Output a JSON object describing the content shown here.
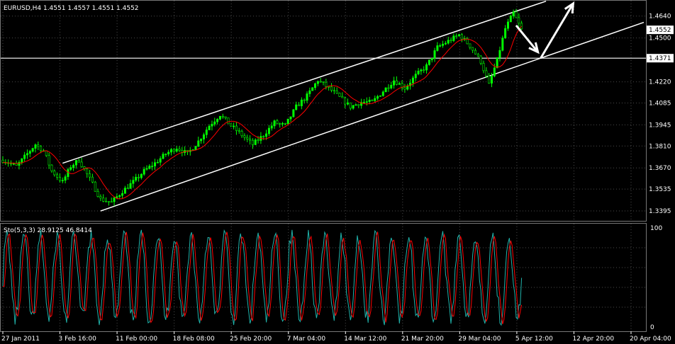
{
  "chart_data": [
    {
      "type": "candlestick",
      "title": "EURUSD,H4  1.4551 1.4557 1.4551 1.4552",
      "ylim": [
        1.335,
        1.472
      ],
      "y_ticks": [
        "1.4640",
        "1.4500",
        "1.4220",
        "1.4085",
        "1.3945",
        "1.3810",
        "1.3670",
        "1.3535",
        "1.3395"
      ],
      "y_tick_values": [
        1.464,
        1.45,
        1.422,
        1.4085,
        1.3945,
        1.381,
        1.367,
        1.3535,
        1.3395
      ],
      "x_ticks": [
        "27 Jan 2011",
        "3 Feb 16:00",
        "11 Feb 00:00",
        "18 Feb 08:00",
        "25 Feb 20:00",
        "7 Mar 04:00",
        "14 Mar 12:00",
        "21 Mar 20:00",
        "29 Mar 04:00",
        "5 Apr 12:00",
        "12 Apr 20:00",
        "20 Apr 04:00"
      ],
      "price_curve": [
        [
          0,
          1.372
        ],
        [
          5,
          1.368
        ],
        [
          9,
          1.376
        ],
        [
          12,
          1.382
        ],
        [
          15,
          1.378
        ],
        [
          18,
          1.365
        ],
        [
          22,
          1.358
        ],
        [
          25,
          1.368
        ],
        [
          28,
          1.372
        ],
        [
          32,
          1.36
        ],
        [
          36,
          1.347
        ],
        [
          40,
          1.345
        ],
        [
          44,
          1.352
        ],
        [
          48,
          1.358
        ],
        [
          52,
          1.365
        ],
        [
          56,
          1.37
        ],
        [
          60,
          1.376
        ],
        [
          64,
          1.38
        ],
        [
          68,
          1.376
        ],
        [
          72,
          1.384
        ],
        [
          76,
          1.394
        ],
        [
          80,
          1.401
        ],
        [
          84,
          1.394
        ],
        [
          88,
          1.388
        ],
        [
          92,
          1.382
        ],
        [
          96,
          1.388
        ],
        [
          100,
          1.396
        ],
        [
          104,
          1.394
        ],
        [
          108,
          1.406
        ],
        [
          112,
          1.413
        ],
        [
          116,
          1.423
        ],
        [
          120,
          1.418
        ],
        [
          124,
          1.412
        ],
        [
          128,
          1.406
        ],
        [
          132,
          1.409
        ],
        [
          136,
          1.409
        ],
        [
          140,
          1.416
        ],
        [
          144,
          1.423
        ],
        [
          148,
          1.418
        ],
        [
          152,
          1.426
        ],
        [
          156,
          1.432
        ],
        [
          160,
          1.444
        ],
        [
          164,
          1.448
        ],
        [
          168,
          1.452
        ],
        [
          172,
          1.445
        ],
        [
          176,
          1.435
        ],
        [
          179,
          1.42
        ],
        [
          182,
          1.436
        ],
        [
          185,
          1.456
        ],
        [
          188,
          1.466
        ],
        [
          191,
          1.4552
        ]
      ],
      "x_max": 236,
      "ma_lag": 3,
      "levels": [
        {
          "label": "1.4552",
          "value": 1.4552,
          "line": false
        },
        {
          "label": "1.4371",
          "value": 1.4371,
          "line": true
        }
      ],
      "trend_lines": [
        {
          "from": [
            22,
            1.37
          ],
          "to": [
            200,
            1.4735
          ]
        },
        {
          "from": [
            36,
            1.3395
          ],
          "to": [
            236,
            1.46
          ]
        }
      ],
      "arrows": [
        {
          "from": [
            189,
            1.458
          ],
          "to": [
            197,
            1.441
          ]
        },
        {
          "from": [
            198,
            1.437
          ],
          "to": [
            210,
            1.472
          ]
        }
      ],
      "colors": {
        "up": "#00ff00",
        "down": "#000000",
        "wick": "#00ff00",
        "ma": "#ff0000",
        "grid": "#4a4a4a",
        "levels": "#ffffff",
        "text": "#ffffff"
      }
    },
    {
      "type": "line",
      "title": "Sto(5,3,3) 28.9125 46.8414",
      "ylim": [
        0,
        100
      ],
      "y_ticks": [
        "100",
        "0"
      ],
      "y_tick_values": [
        100,
        0
      ],
      "cycles": 31,
      "series": [
        {
          "color": "#20b2aa",
          "phase": 0
        },
        {
          "color": "#ff0000",
          "phase": 1
        }
      ],
      "grid_values": [
        20,
        40,
        60,
        80
      ]
    }
  ]
}
